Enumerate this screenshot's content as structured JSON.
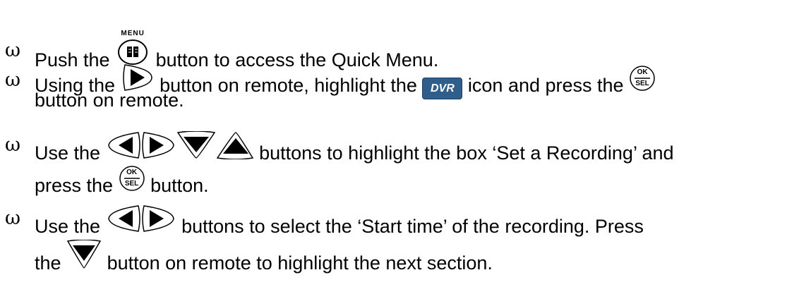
{
  "bullet_symbol": "ω",
  "icons": {
    "menu_button_label": "MENU",
    "dvr_icon_label": "DVR",
    "ok_label": "OK",
    "sel_label": "SEL"
  },
  "items": [
    {
      "parts": [
        "Push the",
        "button to access the Quick Menu."
      ]
    },
    {
      "parts": [
        "Using the",
        "button on remote, highlight the",
        "icon and press the",
        "button on remote."
      ]
    },
    {
      "parts": [
        "Use the",
        "buttons to highlight the box ‘Set a Recording’ and",
        "press the",
        "button."
      ]
    },
    {
      "parts": [
        "Use the",
        "buttons to select the ‘Start time’ of the recording.  Press",
        "the",
        "button on remote to highlight the next section."
      ]
    }
  ]
}
